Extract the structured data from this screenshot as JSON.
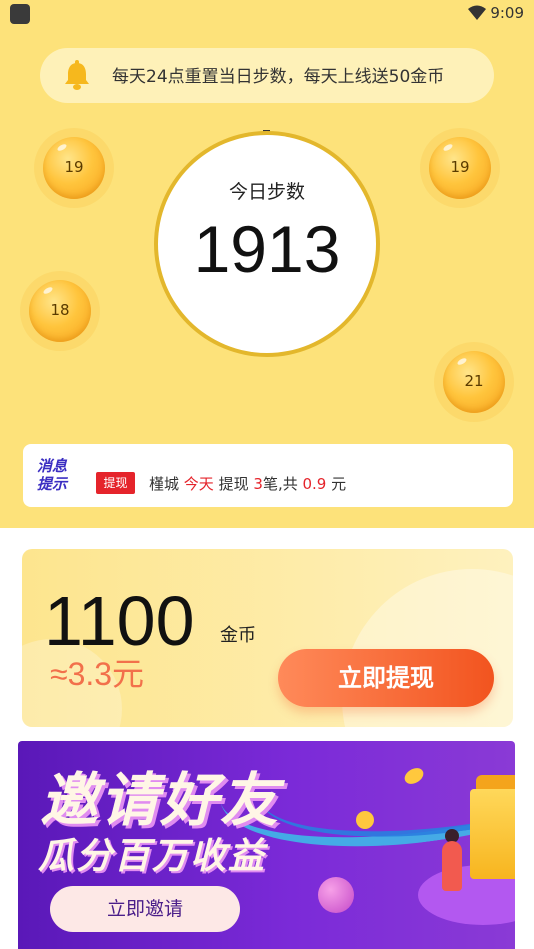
{
  "status_bar": {
    "time": "9:09"
  },
  "notice": {
    "text": "每天24点重置当日步数，每天上线送50金币"
  },
  "coins": [
    {
      "value": "19"
    },
    {
      "value": "19"
    },
    {
      "value": "18"
    },
    {
      "value": "21"
    }
  ],
  "steps": {
    "label": "今日步数",
    "value": "1913"
  },
  "message": {
    "title_line1": "消息",
    "title_line2": "提示",
    "tag": "提现",
    "user": "槿城",
    "today": "今天",
    "action": "提现",
    "count": "3",
    "count_unit": "笔,共",
    "amount": "0.9",
    "currency": "元"
  },
  "balance": {
    "amount": "1100",
    "unit": "金币",
    "approx": "≈3.3元",
    "withdraw_label": "立即提现"
  },
  "invite": {
    "title_line1": "邀请好友",
    "title_line2": "瓜分百万收益",
    "button_label": "立即邀请"
  },
  "colors": {
    "background_yellow": "#fde27a",
    "accent_orange": "#f2541f",
    "accent_red": "#e5242b",
    "banner_purple": "#6a22c8"
  }
}
